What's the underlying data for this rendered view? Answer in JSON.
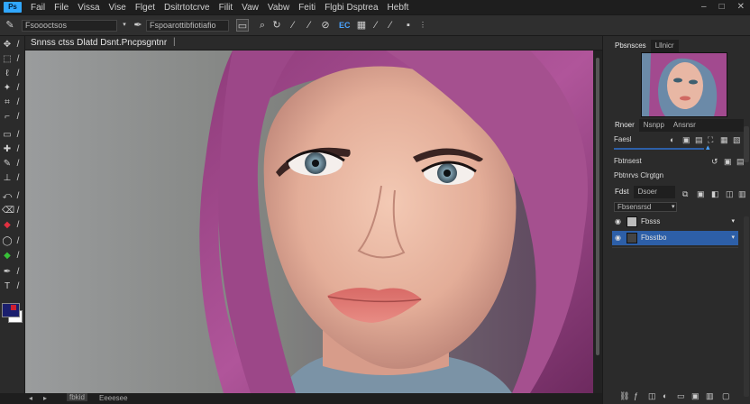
{
  "menubar": {
    "logo": "Ps",
    "items": [
      "Fail",
      "File",
      "Vissa",
      "Vise",
      "Flget",
      "Dsitrtotcrve",
      "Filit",
      "Vaw",
      "Vabw",
      "Feiti",
      "Flgbi Dsptrea",
      "Hebft"
    ],
    "window_controls": [
      "–",
      "□",
      "✕"
    ]
  },
  "optbar": {
    "preset_field": "Fsoooctsos",
    "mode_field": "Fspoarottibfiotiafio",
    "badge": "EC"
  },
  "document": {
    "tab_title": "Snnss ctss Dlatd Dsnt.Pncpsgntnr",
    "tab_close": "|"
  },
  "statusbar": {
    "items": [
      "fbkid",
      "Eeeesee"
    ]
  },
  "panels": {
    "navigator": {
      "tabs": [
        "Pbsnsces",
        "Lllnicr"
      ]
    },
    "properties": {
      "tabs": [
        "Rnoer",
        "Nsnpp",
        "Ansnsr"
      ],
      "row1_label": "Faesl",
      "row2_label": "Fbtnsest",
      "row3_label": "Pbtnrvs Clrgtgn"
    },
    "layers": {
      "tabs": [
        "Fdst",
        "Dsoer"
      ],
      "blend_field": "Fbsensrsd",
      "items": [
        {
          "name": "Fbsss",
          "selected": false
        },
        {
          "name": "Fbsstbo",
          "selected": true
        }
      ]
    }
  },
  "colors": {
    "accent_blue": "#2d5fa8",
    "foreground": "#1b1f6e",
    "background": "#ffffff"
  }
}
